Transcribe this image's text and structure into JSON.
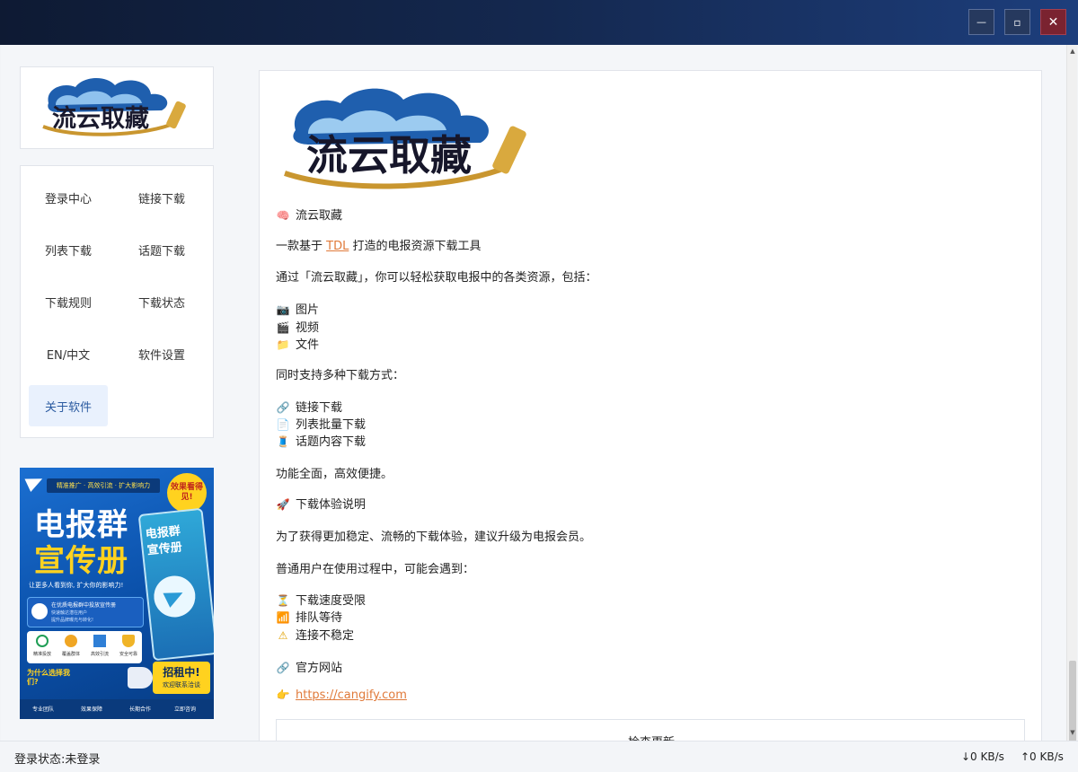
{
  "window": {
    "minimize_glyph": "—",
    "maximize_glyph": "▫",
    "close_glyph": "✕"
  },
  "brand": {
    "logo_text": "流云取藏"
  },
  "nav": {
    "items": [
      {
        "label": "登录中心"
      },
      {
        "label": "链接下载"
      },
      {
        "label": "列表下载"
      },
      {
        "label": "话题下载"
      },
      {
        "label": "下载规则"
      },
      {
        "label": "下载状态"
      },
      {
        "label": "EN/中文"
      },
      {
        "label": "软件设置"
      },
      {
        "label": "关于软件"
      }
    ],
    "active_index": 8
  },
  "ad": {
    "top_banner": "精准推广 · 高效引流 · 扩大影响力",
    "badge": "效果看得见!",
    "headline_1": "电报群",
    "headline_2": "宣传册",
    "book_title_1": "电报群",
    "book_title_2": "宣传册",
    "slogan": "让更多人看到你, 扩大你的影响力!",
    "feature_title": "在优质电报群中投放宣传册",
    "feature_sub_1": "快速触达潜在用户",
    "feature_sub_2": "提升品牌曝光与转化!",
    "icons": [
      "精准投放",
      "覆盖群体",
      "高效引流",
      "安全可靠"
    ],
    "why": "为什么选择我们?",
    "cta_1": "招租中!",
    "cta_2": "欢迎联系洽谈",
    "bottom": [
      "专业团队",
      "效果保障",
      "长期合作",
      "立即咨询"
    ]
  },
  "content": {
    "title": "流云取藏",
    "intro_prefix": "一款基于 ",
    "intro_link": "TDL",
    "intro_suffix": " 打造的电报资源下载工具",
    "desc": "通过「流云取藏」，你可以轻松获取电报中的各类资源，包括：",
    "resources": [
      {
        "icon": "📷",
        "label": "图片"
      },
      {
        "icon": "🎬",
        "label": "视频"
      },
      {
        "icon": "📁",
        "label": "文件"
      }
    ],
    "modes_intro": "同时支持多种下载方式：",
    "modes": [
      {
        "icon": "🔗",
        "label": "链接下载"
      },
      {
        "icon": "📄",
        "label": "列表批量下载"
      },
      {
        "icon": "🧵",
        "label": "话题内容下载"
      }
    ],
    "summary": "功能全面，高效便捷。",
    "note_title": "下载体验说明",
    "note_desc": "为了获得更加稳定、流畅的下载体验，建议升级为电报会员。",
    "issues_intro": "普通用户在使用过程中，可能会遇到：",
    "issues": [
      {
        "icon": "⏳",
        "label": "下载速度受限"
      },
      {
        "icon": "📶",
        "label": "排队等待"
      },
      {
        "icon": "⚠",
        "label": "连接不稳定"
      }
    ],
    "site_title": "官方网站",
    "site_url": "https://cangify.com",
    "update_button": "检查更新"
  },
  "status": {
    "login_state": "登录状态:未登录",
    "download_speed": "↓0 KB/s",
    "upload_speed": "↑0 KB/s"
  },
  "colors": {
    "accent_link": "#e07a3a",
    "active_nav_bg": "#e9f1fd",
    "title_gradient_start": "#0e1a33",
    "title_gradient_end": "#1d3e7c",
    "close_button": "#7a2330"
  }
}
